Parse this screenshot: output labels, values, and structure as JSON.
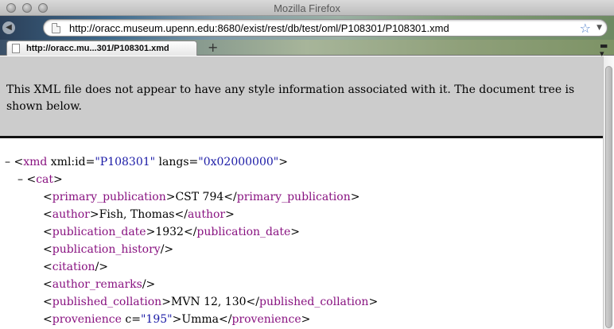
{
  "window": {
    "title": "Mozilla Firefox"
  },
  "navbar": {
    "url": "http://oracc.museum.upenn.edu:8680/exist/rest/db/test/oml/P108301/P108301.xmd"
  },
  "tabs": [
    {
      "label": "http://oracc.mu...301/P108301.xmd",
      "active": true
    }
  ],
  "notice": {
    "text": "This XML file does not appear to have any style information associated with it. The document tree is shown below."
  },
  "xml": {
    "root": {
      "toggle": "–",
      "name": "xmd",
      "attr1_name": "xml:id",
      "attr1_value": "\"P108301\"",
      "attr2_name": "langs",
      "attr2_value": "\"0x02000000\""
    },
    "cat": {
      "toggle": "–",
      "name": "cat"
    },
    "children": [
      {
        "name": "primary_publication",
        "text": "CST 794"
      },
      {
        "name": "author",
        "text": "Fish, Thomas"
      },
      {
        "name": "publication_date",
        "text": "1932"
      },
      {
        "name": "publication_history",
        "empty": true
      },
      {
        "name": "citation",
        "empty": true
      },
      {
        "name": "author_remarks",
        "empty": true
      },
      {
        "name": "published_collation",
        "text": "MVN 12, 130"
      },
      {
        "name": "provenience",
        "attr_name": "c",
        "attr_value": "\"195\"",
        "text": "Umma"
      }
    ]
  },
  "colors": {
    "tag": "#881280",
    "attr_value": "#1a1aa6",
    "notice_bg": "#cccccc"
  },
  "icons": [
    "back-icon",
    "page-icon",
    "star-icon",
    "dropdown-icon",
    "new-tab-icon",
    "tab-list-icon"
  ]
}
